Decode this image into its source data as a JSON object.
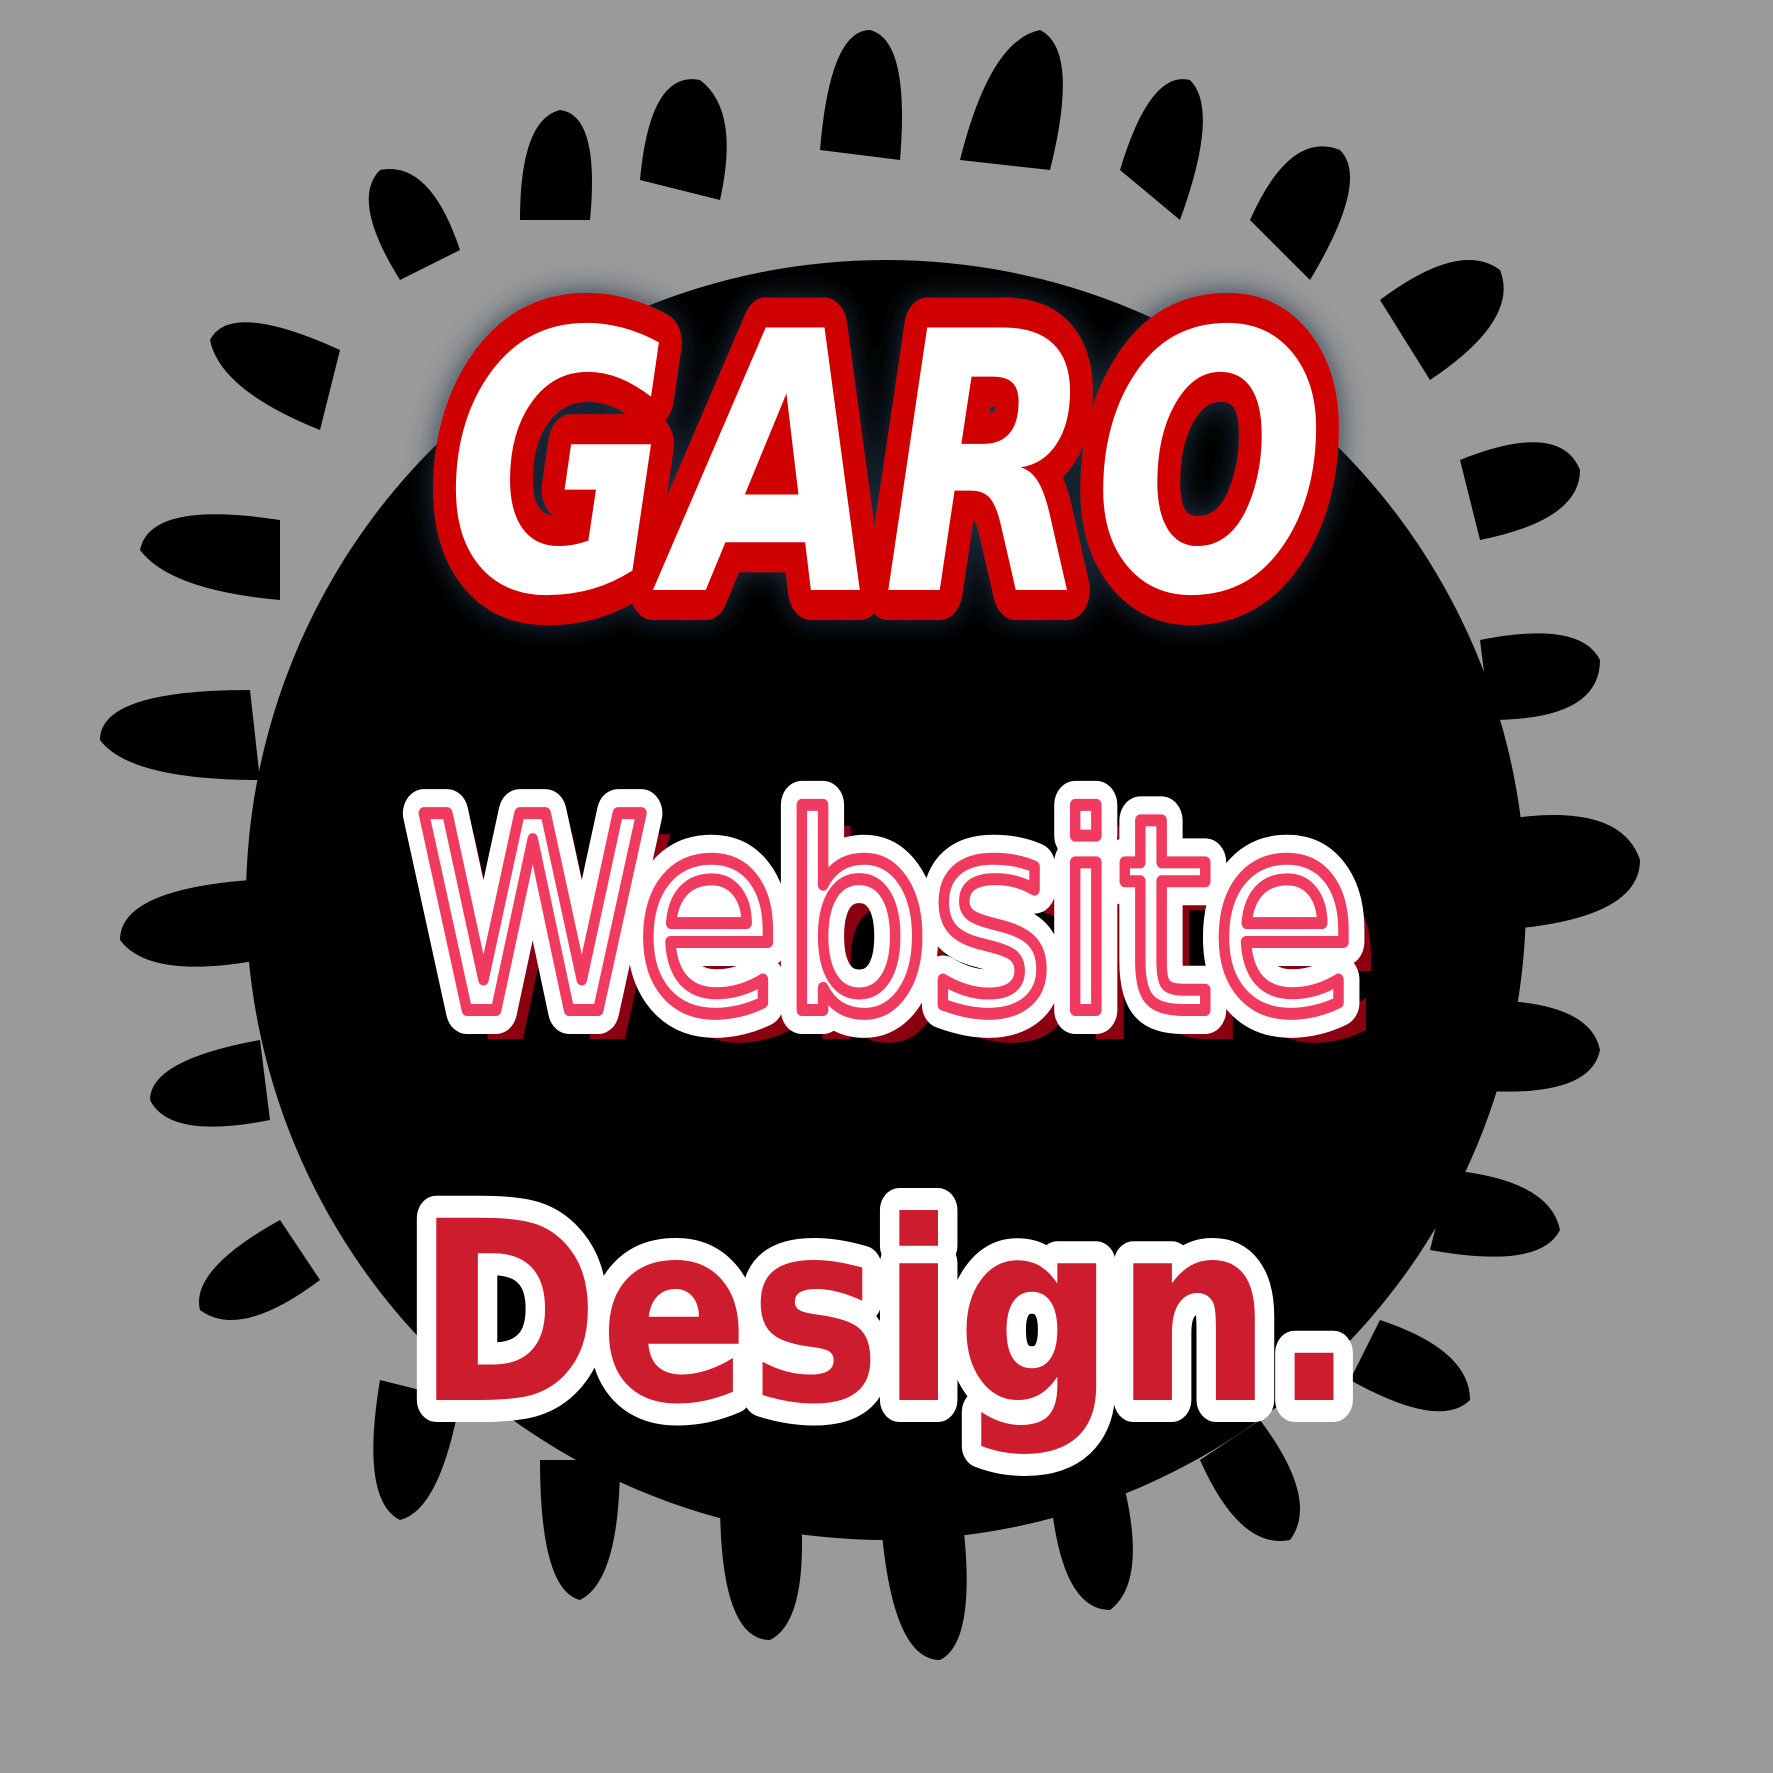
{
  "logo": {
    "line1": "GARO",
    "line2": "Website",
    "line3": "Design."
  },
  "colors": {
    "background": "#9a9a9a",
    "splat": "#000000",
    "garo_fill": "#ffffff",
    "garo_outline": "#d10000",
    "website_fill": "#ffffff",
    "website_outline": "#f03a5f",
    "website_shadow": "#8a0010",
    "design_fill": "#cc1c2e",
    "design_outline": "#ffffff"
  }
}
